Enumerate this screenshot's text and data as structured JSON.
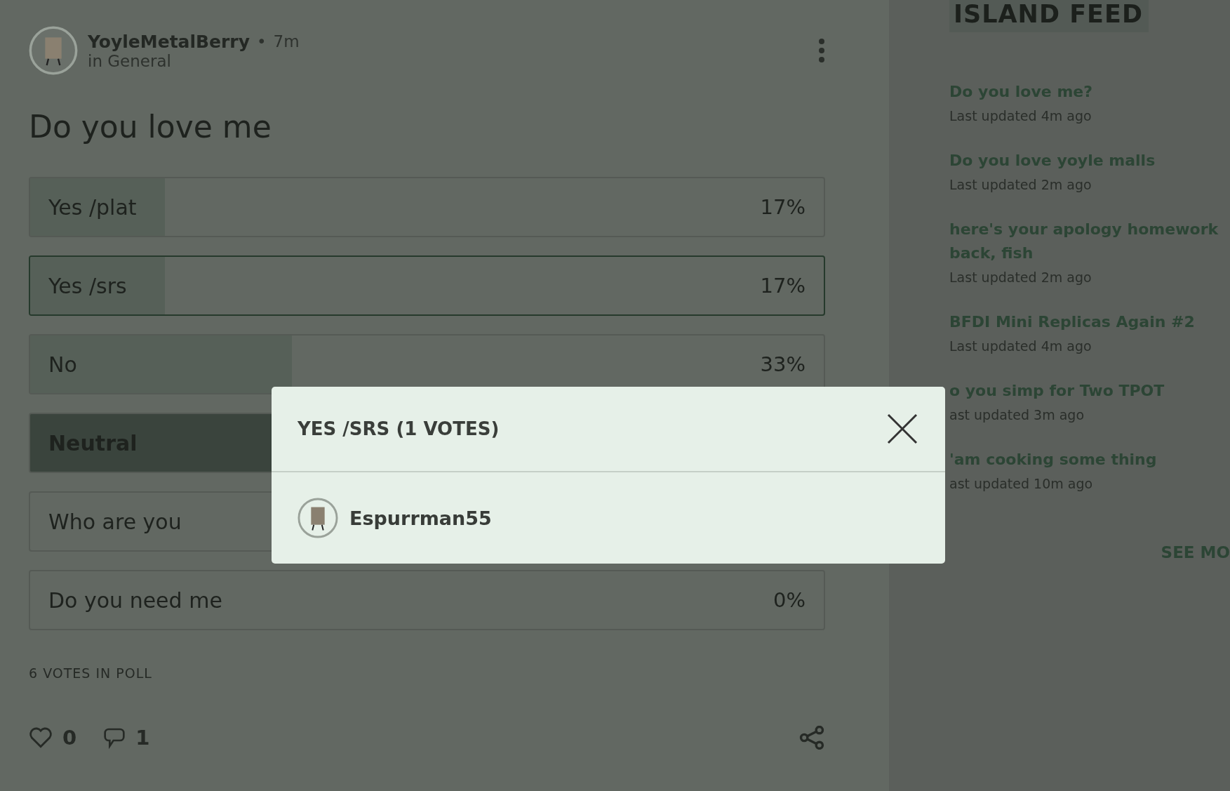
{
  "post": {
    "author": "YoyleMetalBerry",
    "separator": "•",
    "time": "7m",
    "community": "in General",
    "title": "Do you love me",
    "options": [
      {
        "label": "Yes /plat",
        "percent": "17%",
        "level": 0.17,
        "voted": false,
        "selected": false
      },
      {
        "label": "Yes /srs",
        "percent": "17%",
        "level": 0.17,
        "voted": false,
        "selected": true
      },
      {
        "label": "No",
        "percent": "33%",
        "level": 0.33,
        "voted": false,
        "selected": false
      },
      {
        "label": "Neutral",
        "level": 0.33,
        "voted": true,
        "selected": false
      },
      {
        "label": "Who are you",
        "voted": false,
        "selected": false
      },
      {
        "label": "Do you need me",
        "percent": "0%",
        "voted": false,
        "selected": false
      }
    ],
    "total": "6 VOTES IN POLL",
    "likes": "0",
    "comments": "1"
  },
  "feed": {
    "title": "ISLAND FEED",
    "items": [
      {
        "title": "Do you love me?",
        "updated": "Last updated 4m ago"
      },
      {
        "title": "Do you love yoyle malls",
        "updated": "Last updated 2m ago"
      },
      {
        "title": "here's your apology homework back, fish",
        "updated": "Last updated 2m ago"
      },
      {
        "title": "BFDI Mini Replicas Again #2",
        "updated": "Last updated 4m ago"
      },
      {
        "title": "o you simp for Two TPOT",
        "updated": "ast updated 3m ago"
      },
      {
        "title": "'am cooking some thing",
        "updated": "ast updated 10m ago"
      }
    ],
    "more": "SEE MO"
  },
  "modal": {
    "title": "YES /SRS (1 VOTES)",
    "voters": [
      {
        "name": "Espurrman55"
      }
    ]
  }
}
